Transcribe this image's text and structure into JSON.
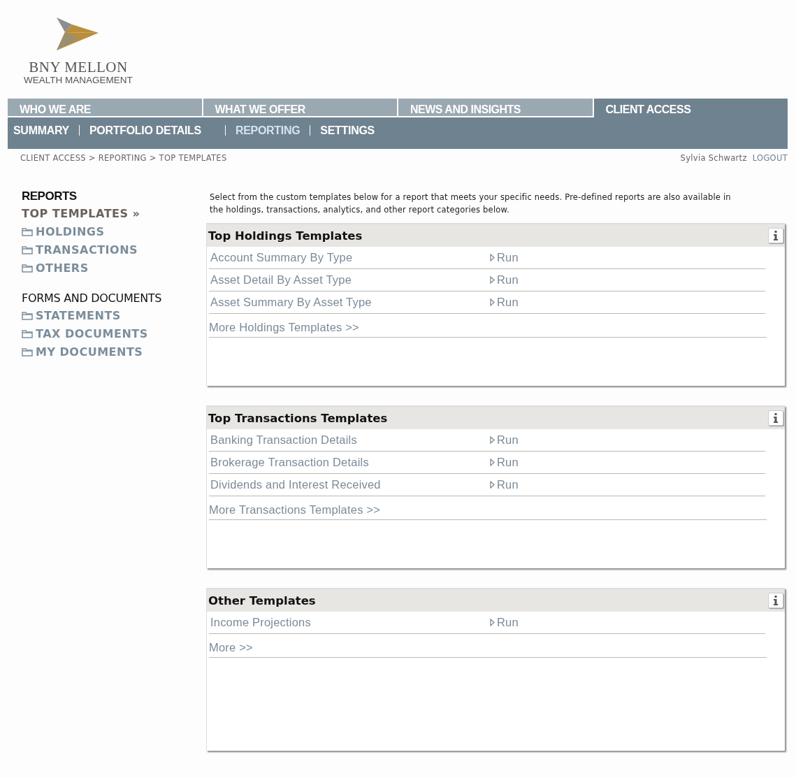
{
  "logo": {
    "name": "BNY MELLON",
    "tagline": "WEALTH MANAGEMENT"
  },
  "main_nav": [
    {
      "label": "WHO WE ARE",
      "selected": false
    },
    {
      "label": "WHAT WE OFFER",
      "selected": false
    },
    {
      "label": "NEWS AND INSIGHTS",
      "selected": false
    },
    {
      "label": "CLIENT ACCESS",
      "selected": true
    }
  ],
  "sub_nav": [
    {
      "label": "SUMMARY",
      "selected": false
    },
    {
      "label": "PORTFOLIO DETAILS",
      "selected": false
    },
    {
      "label": "REPORTING",
      "selected": true
    },
    {
      "label": "SETTINGS",
      "selected": false
    }
  ],
  "breadcrumb": "CLIENT ACCESS > REPORTING > TOP TEMPLATES",
  "user": {
    "name": "Sylvia Schwartz",
    "logout": "LOGOUT"
  },
  "sidebar": [
    {
      "heading": "REPORTS",
      "items": [
        {
          "label": "TOP TEMPLATES »",
          "kind": "current",
          "selected": true
        },
        {
          "label": "HOLDINGS",
          "kind": "folder",
          "selected": false
        },
        {
          "label": "TRANSACTIONS",
          "kind": "folder",
          "selected": false
        },
        {
          "label": "OTHERS",
          "kind": "folder",
          "selected": false
        }
      ]
    },
    {
      "heading": "FORMS AND DOCUMENTS",
      "items": [
        {
          "label": "STATEMENTS",
          "kind": "folder",
          "selected": false
        },
        {
          "label": "TAX DOCUMENTS",
          "kind": "folder",
          "selected": false
        },
        {
          "label": "MY DOCUMENTS",
          "kind": "folder",
          "selected": false
        }
      ]
    }
  ],
  "intro": "Select from the custom templates below for a report that meets your specific needs. Pre-defined reports are also available in the holdings, transactions, analytics, and other report categories below.",
  "panels": [
    {
      "title": "Top Holdings Templates",
      "rows": [
        {
          "name": "Account Summary By Type",
          "action": "Run"
        },
        {
          "name": "Asset Detail By Asset Type",
          "action": "Run"
        },
        {
          "name": "Asset Summary By Asset Type",
          "action": "Run"
        }
      ],
      "more": "More Holdings Templates >>"
    },
    {
      "title": "Top Transactions Templates",
      "rows": [
        {
          "name": "Banking Transaction Details",
          "action": "Run"
        },
        {
          "name": "Brokerage Transaction Details",
          "action": "Run"
        },
        {
          "name": "Dividends and Interest Received",
          "action": "Run"
        }
      ],
      "more": "More Transactions Templates >>"
    },
    {
      "title": "Other Templates",
      "rows": [
        {
          "name": "Income Projections",
          "action": "Run"
        }
      ],
      "more": "More >>"
    }
  ]
}
